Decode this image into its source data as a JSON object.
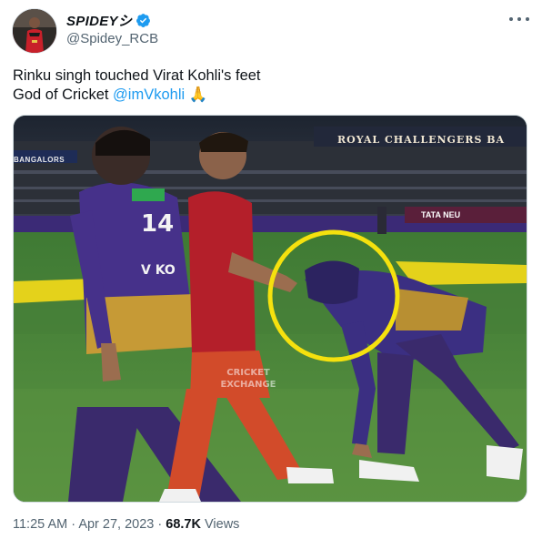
{
  "author": {
    "display_name": "SPIDEYシ",
    "handle": "@Spidey_RCB",
    "verified_icon": "verified-badge-icon",
    "accent_color": "#1d9bf0"
  },
  "tweet": {
    "line1": "Rinku singh touched Virat Kohli's feet",
    "line2_prefix": "God of Cricket ",
    "mention": "@imVkohli",
    "emoji": "🙏"
  },
  "media": {
    "board_left": "BANGALORS",
    "board_top": "ROYAL CHALLENGERS BA",
    "board_tata": "TATA  NEU",
    "player_number": "14",
    "player_name": "V KO",
    "watermark_line1": "CRICKET",
    "watermark_line2": "EXCHANGE",
    "highlight_color": "#f5e10e"
  },
  "meta": {
    "time": "11:25 AM",
    "separator": "·",
    "date": "Apr 27, 2023",
    "views_count": "68.7K",
    "views_label": "Views"
  }
}
